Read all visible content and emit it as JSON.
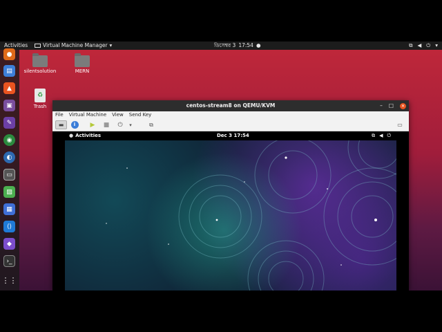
{
  "topbar": {
    "activities": "Activities",
    "app_name": "Virtual Machine Manager",
    "clock_date": "ডিসেম্বর 3",
    "clock_time": "17:54"
  },
  "desktop": {
    "icons": [
      {
        "label": "silentsolution",
        "icon": "home-folder-icon"
      },
      {
        "label": "MERN",
        "icon": "folder-icon"
      },
      {
        "label": "Trash",
        "icon": "trash-icon"
      }
    ]
  },
  "window": {
    "title": "centos-stream8 on QEMU/KVM",
    "menu": [
      "File",
      "Virtual Machine",
      "View",
      "Send Key"
    ]
  },
  "guest": {
    "activities": "Activities",
    "clock": "Dec 3  17:54"
  },
  "colors": {
    "accent": "#e95420",
    "desktop_top": "#c1283a",
    "desktop_bottom": "#3b1236",
    "panel": "#1c1c1c"
  }
}
